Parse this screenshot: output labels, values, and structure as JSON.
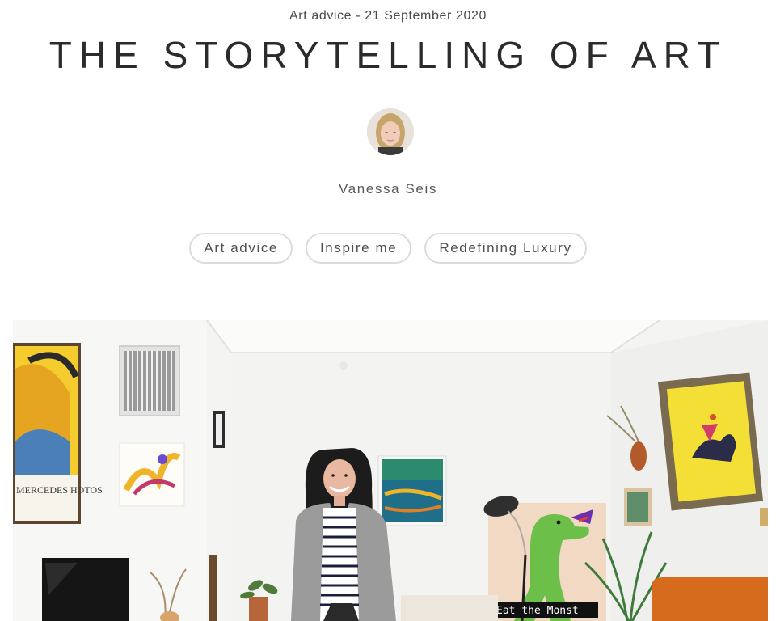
{
  "article": {
    "category": "Art advice",
    "separator": " - ",
    "date": "21 September 2020",
    "title": "THE STORYTELLING OF ART"
  },
  "author": {
    "name": "Vanessa Seis"
  },
  "tags": [
    "Art advice",
    "Inspire me",
    "Redefining Luxury"
  ],
  "hero": {
    "poster_text": "MERCEDES HOTOS",
    "sign_text": "Eat the Monst"
  },
  "colors": {
    "accent_yellow": "#f4cc2e",
    "orange_sofa": "#d66b1e",
    "dino_green": "#6cc04a"
  }
}
